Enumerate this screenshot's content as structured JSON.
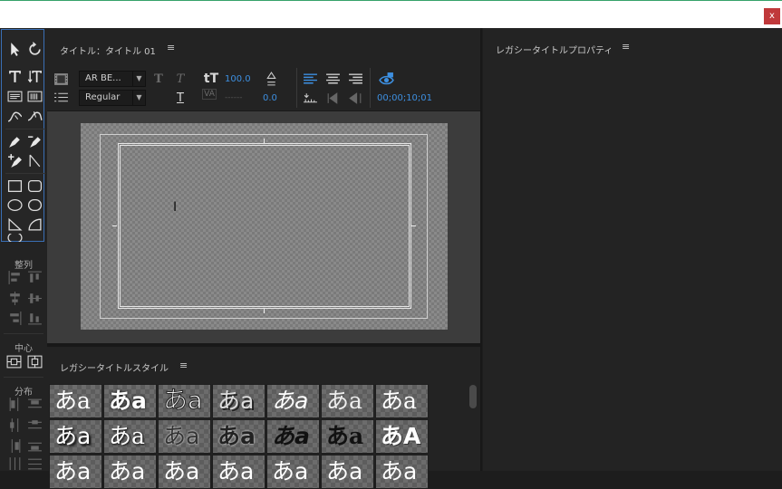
{
  "window": {
    "close_label": "x"
  },
  "main_panel": {
    "title": "タイトル：タイトル 01",
    "menu_glyph": "≡"
  },
  "options": {
    "font_family": "AR BE...",
    "font_style": "Regular",
    "font_size": "100.0",
    "kerning": "0.0",
    "timecode": "00;00;10;01"
  },
  "tools_panel": {
    "align_label": "整列",
    "center_label": "中心",
    "distribute_label": "分布"
  },
  "styles_panel": {
    "title": "レガシータイトルスタイル",
    "menu_glyph": "≡"
  },
  "properties_panel": {
    "title": "レガシータイトルプロパティ",
    "menu_glyph": "≡"
  },
  "styles": [
    {
      "text": "あa"
    },
    {
      "text": "あa"
    },
    {
      "text": "あa"
    },
    {
      "text": "あa"
    },
    {
      "text": "あa"
    },
    {
      "text": "あa"
    },
    {
      "text": "あa"
    },
    {
      "text": "あa"
    },
    {
      "text": "あa"
    },
    {
      "text": "あa"
    },
    {
      "text": "あa"
    },
    {
      "text": "あa"
    },
    {
      "text": "あa"
    },
    {
      "text": "あA"
    },
    {
      "text": "あa"
    },
    {
      "text": "あa"
    },
    {
      "text": "あa"
    },
    {
      "text": "あa"
    },
    {
      "text": "あa"
    },
    {
      "text": "あa"
    },
    {
      "text": "あa"
    }
  ],
  "colors": {
    "accent": "#3d8fe0",
    "close": "#c0393b",
    "selection_border": "#3a6fb5"
  }
}
